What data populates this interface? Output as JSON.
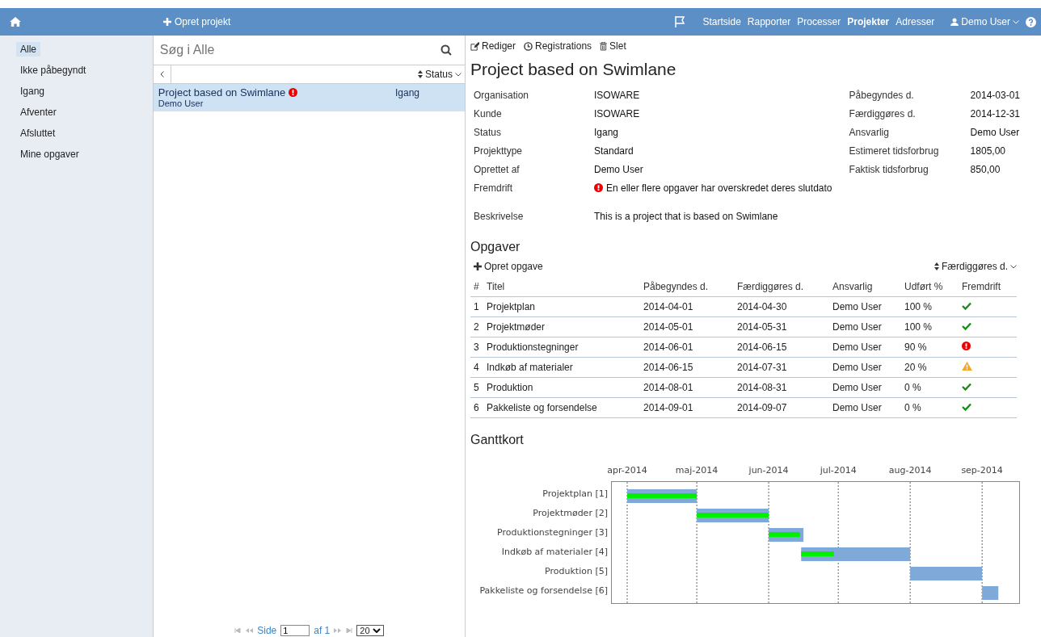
{
  "topbar": {
    "create_label": "Opret projekt",
    "nav": [
      {
        "label": "Startside",
        "selected": false
      },
      {
        "label": "Rapporter",
        "selected": false
      },
      {
        "label": "Processer",
        "selected": false
      },
      {
        "label": "Projekter",
        "selected": true
      },
      {
        "label": "Adresser",
        "selected": false
      }
    ],
    "user": "Demo User"
  },
  "sidebar": {
    "items": [
      {
        "label": "Alle",
        "selected": true
      },
      {
        "label": "Ikke påbegyndt",
        "selected": false
      },
      {
        "label": "Igang",
        "selected": false
      },
      {
        "label": "Afventer",
        "selected": false
      },
      {
        "label": "Afsluttet",
        "selected": false
      },
      {
        "label": "Mine opgaver",
        "selected": false
      }
    ]
  },
  "list": {
    "search_placeholder": "Søg i Alle",
    "sort_label": "Status",
    "items": [
      {
        "title": "Project based on Swimlane",
        "owner": "Demo User",
        "status": "Igang",
        "overdue": true,
        "selected": true
      }
    ],
    "pager": {
      "page_label": "Side",
      "page": "1",
      "of_label": "af 1",
      "page_size": "20"
    }
  },
  "detail": {
    "actions": [
      "Rediger",
      "Registrations",
      "Slet"
    ],
    "title": "Project based on Swimlane",
    "fields_left": [
      {
        "label": "Organisation",
        "value": "ISOWARE"
      },
      {
        "label": "Kunde",
        "value": "ISOWARE"
      },
      {
        "label": "Status",
        "value": "Igang"
      },
      {
        "label": "Projekttype",
        "value": "Standard"
      },
      {
        "label": "Oprettet af",
        "value": "Demo User"
      }
    ],
    "fields_right": [
      {
        "label": "Påbegyndes d.",
        "value": "2014-03-01"
      },
      {
        "label": "Færdiggøres d.",
        "value": "2014-12-31"
      },
      {
        "label": "Ansvarlig",
        "value": "Demo User"
      },
      {
        "label": "Estimeret tidsforbrug",
        "value": "1805,00"
      },
      {
        "label": "Faktisk tidsforbrug",
        "value": "850,00"
      }
    ],
    "progress": {
      "label": "Fremdrift",
      "text": "En eller flere opgaver har overskredet deres slutdato"
    },
    "description": {
      "label": "Beskrivelse",
      "text": "This is a project that is based on Swimlane"
    },
    "tasks": {
      "heading": "Opgaver",
      "create_label": "Opret opgave",
      "sort_label": "Færdiggøres d.",
      "columns": [
        "#",
        "Titel",
        "Påbegyndes d.",
        "Færdiggøres d.",
        "Ansvarlig",
        "Udført %",
        "Fremdrift"
      ],
      "rows": [
        {
          "num": "1",
          "title": "Projektplan",
          "start": "2014-04-01",
          "end": "2014-04-30",
          "owner": "Demo User",
          "done": "100 %",
          "kind": "ok"
        },
        {
          "num": "2",
          "title": "Projektmøder",
          "start": "2014-05-01",
          "end": "2014-05-31",
          "owner": "Demo User",
          "done": "100 %",
          "kind": "ok"
        },
        {
          "num": "3",
          "title": "Produktionstegninger",
          "start": "2014-06-01",
          "end": "2014-06-15",
          "owner": "Demo User",
          "done": "90 %",
          "kind": "overdue"
        },
        {
          "num": "4",
          "title": "Indkøb af materialer",
          "start": "2014-06-15",
          "end": "2014-07-31",
          "owner": "Demo User",
          "done": "20 %",
          "kind": "warning"
        },
        {
          "num": "5",
          "title": "Produktion",
          "start": "2014-08-01",
          "end": "2014-08-31",
          "owner": "Demo User",
          "done": "0 %",
          "kind": "ok"
        },
        {
          "num": "6",
          "title": "Pakkeliste og forsendelse",
          "start": "2014-09-01",
          "end": "2014-09-07",
          "owner": "Demo User",
          "done": "0 %",
          "kind": "ok"
        }
      ]
    },
    "gantt": {
      "heading": "Ganttkort",
      "months": [
        "apr-2014",
        "maj-2014",
        "jun-2014",
        "jul-2014",
        "aug-2014",
        "sep-2014"
      ],
      "rows": [
        {
          "label": "Projektplan [1]",
          "level": 1
        },
        {
          "label": "Projektmøder [2]",
          "level": 1
        },
        {
          "label": "Produktionstegninger [3]",
          "level": 0.9
        },
        {
          "label": "Indkøb af materialer [4]",
          "level": 0.3
        },
        {
          "label": "Produktion [5]"
        },
        {
          "label": "Pakkeliste og forsendelse [6]"
        }
      ]
    }
  }
}
